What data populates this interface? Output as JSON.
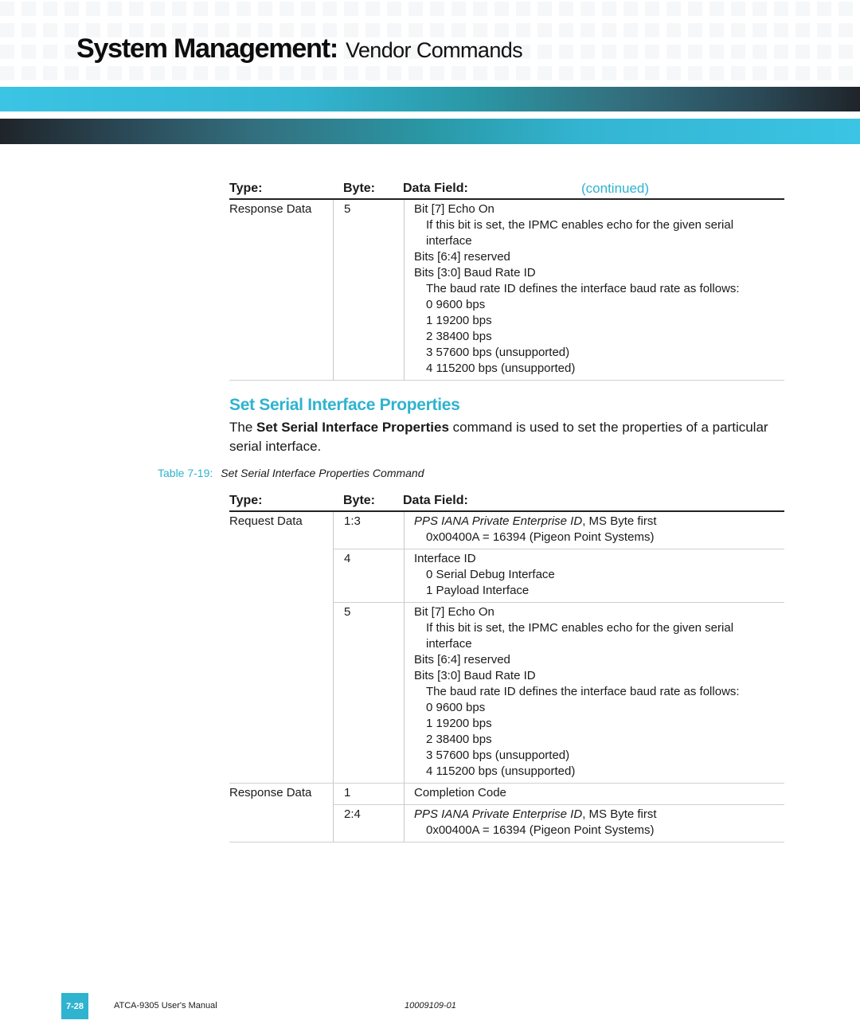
{
  "header": {
    "title_main": "System Management:",
    "title_sub": "Vendor Commands"
  },
  "table_continued": {
    "columns": {
      "type": "Type:",
      "byte": "Byte:",
      "field": "Data Field:"
    },
    "continued_label": "(continued)",
    "rows": [
      {
        "type": "Response Data",
        "byte": "5",
        "lines": [
          "Bit [7] Echo On",
          "If this bit is set, the IPMC enables echo for the given serial",
          "interface",
          "Bits [6:4] reserved",
          "Bits [3:0] Baud Rate ID",
          "The baud rate ID defines the interface baud rate as follows:",
          "0  9600 bps",
          "1  19200 bps",
          "2  38400 bps",
          "3  57600 bps (unsupported)",
          "4  115200 bps (unsupported)"
        ]
      }
    ]
  },
  "section": {
    "heading": "Set Serial Interface Properties",
    "para_prefix": "The ",
    "para_bold": "Set Serial Interface Properties",
    "para_suffix": " command is used to set the properties of a particular serial interface."
  },
  "caption": {
    "label": "Table 7-19:",
    "title": "Set Serial Interface Properties Command"
  },
  "table_main": {
    "columns": {
      "type": "Type:",
      "byte": "Byte:",
      "field": "Data Field:"
    },
    "request": {
      "type": "Request Data",
      "rows": [
        {
          "byte": "1:3",
          "field_italic": "PPS IANA Private Enterprise ID",
          "field_rest": ", MS Byte first",
          "lines": [
            "0x00400A = 16394 (Pigeon Point Systems)"
          ]
        },
        {
          "byte": "4",
          "title": "Interface ID",
          "lines": [
            "0  Serial Debug Interface",
            "1  Payload Interface"
          ]
        },
        {
          "byte": "5",
          "title": "Bit [7] Echo On",
          "lines": [
            "If this bit is set, the IPMC enables echo for the given serial",
            "interface",
            "Bits [6:4] reserved",
            "Bits [3:0] Baud Rate ID",
            "The baud rate ID defines the interface baud rate as follows:",
            "0  9600 bps",
            "1  19200 bps",
            "2  38400 bps",
            "3  57600 bps (unsupported)",
            "4  115200 bps (unsupported)"
          ]
        }
      ]
    },
    "response": {
      "type": "Response Data",
      "rows": [
        {
          "byte": "1",
          "title": "Completion Code"
        },
        {
          "byte": "2:4",
          "field_italic": "PPS IANA Private Enterprise ID",
          "field_rest": ", MS Byte first",
          "lines": [
            "0x00400A = 16394 (Pigeon Point Systems)"
          ]
        }
      ]
    }
  },
  "footer": {
    "page": "7-28",
    "manual": "ATCA-9305 User's Manual",
    "doc_number": "10009109-01"
  },
  "colors": {
    "accent": "#2fb3cf",
    "dark": "#1f2429"
  }
}
